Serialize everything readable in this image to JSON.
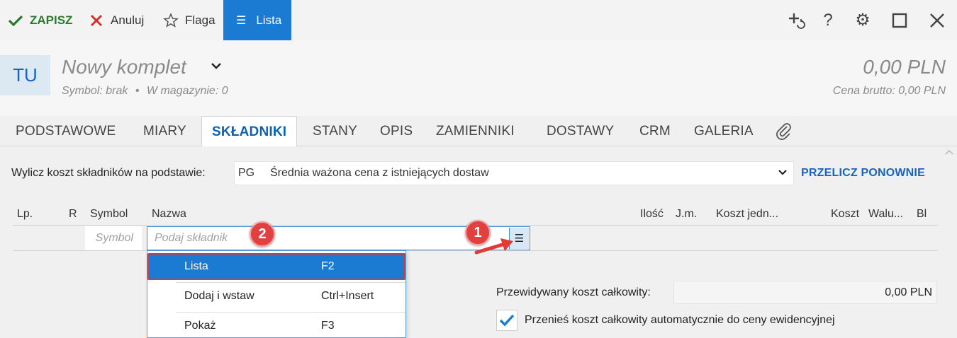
{
  "toolbar": {
    "save": "ZAPISZ",
    "cancel": "Anuluj",
    "flag": "Flaga",
    "list": "Lista",
    "colors": {
      "save": "#2b7a2b",
      "cancel": "#d32f2f",
      "list_bg": "#1b7bd2"
    },
    "right_icons": [
      "add-refresh-icon",
      "help-icon",
      "gear-icon",
      "maximize-icon",
      "close-icon"
    ]
  },
  "header": {
    "avatar": "TU",
    "title": "Nowy komplet",
    "symbol": "Symbol: brak",
    "stock": "W magazynie: 0",
    "price": "0,00 PLN",
    "price_gross": "Cena brutto: 0,00 PLN"
  },
  "tabs": [
    "PODSTAWOWE",
    "MIARY",
    "SKŁADNIKI",
    "STANY",
    "OPIS",
    "ZAMIENNIKI",
    "DOSTAWY",
    "CRM",
    "GALERIA"
  ],
  "active_tab": "SKŁADNIKI",
  "cost_basis": {
    "label": "Wylicz koszt składników na podstawie:",
    "code": "PG",
    "value": "Średnia ważona cena z istniejących dostaw",
    "recalc": "PRZELICZ PONOWNIE"
  },
  "grid": {
    "columns": [
      "Lp.",
      "R",
      "Symbol",
      "Nazwa",
      "Ilość",
      "J.m.",
      "Koszt jedn...",
      "Koszt",
      "Walu...",
      "Bl"
    ],
    "symbol_placeholder": "Symbol",
    "name_placeholder": "Podaj składnik"
  },
  "annotations": {
    "badge1": "1",
    "badge2": "2"
  },
  "dropdown": [
    {
      "label": "Lista",
      "key": "F2"
    },
    {
      "label": "Dodaj i wstaw",
      "key": "Ctrl+Insert"
    },
    {
      "label": "Pokaż",
      "key": "F3"
    }
  ],
  "summary": {
    "cost_label": "Przewidywany koszt całkowity:",
    "cost_value": "0,00 PLN",
    "transfer_label": "Przenieś koszt całkowity automatycznie do ceny ewidencyjnej",
    "transfer_checked": true
  }
}
